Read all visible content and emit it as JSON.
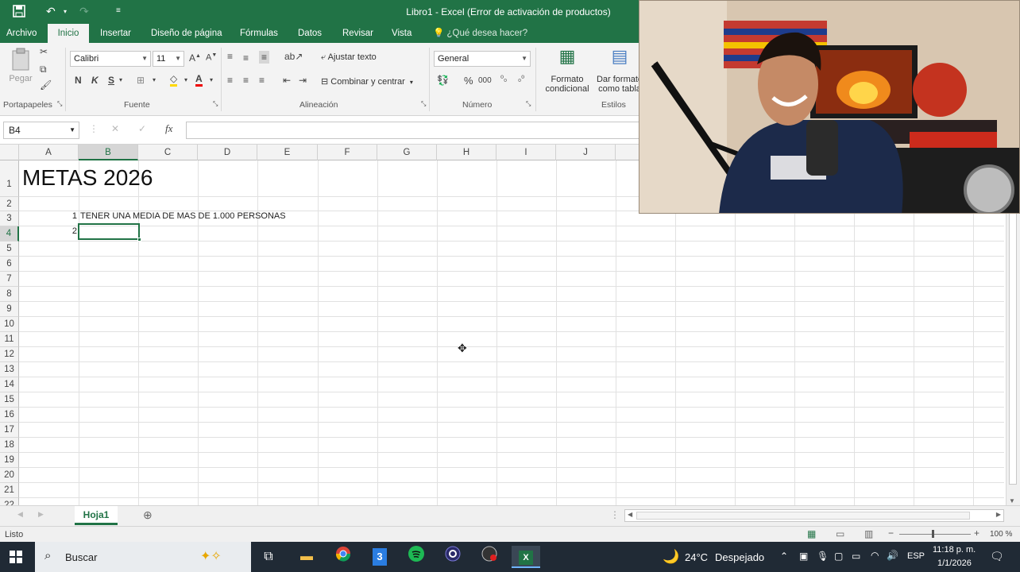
{
  "app": {
    "title": "Libro1 - Excel (Error de activación de productos)",
    "tabs": [
      "Archivo",
      "Inicio",
      "Insertar",
      "Diseño de página",
      "Fórmulas",
      "Datos",
      "Revisar",
      "Vista"
    ],
    "tell_me": "¿Qué desea hacer?"
  },
  "ribbon": {
    "paste_label": "Pegar",
    "font_name": "Calibri",
    "font_size": "11",
    "bold": "N",
    "italic": "K",
    "underline": "S",
    "wrap_text": "Ajustar texto",
    "merge_center": "Combinar y centrar",
    "number_format": "General",
    "percent": "%",
    "thousands": "000",
    "cond_format_1": "Formato",
    "cond_format_2": "condicional",
    "table_format_1": "Dar formato",
    "table_format_2": "como tabla",
    "groups": {
      "clipboard": "Portapapeles",
      "font": "Fuente",
      "alignment": "Alineación",
      "number": "Número",
      "styles": "Estilos"
    }
  },
  "formula_bar": {
    "name_box": "B4",
    "fx": "fx",
    "formula": ""
  },
  "grid": {
    "columns": [
      "A",
      "B",
      "C",
      "D",
      "E",
      "F",
      "G",
      "H",
      "I",
      "J"
    ],
    "rows": [
      "1",
      "2",
      "3",
      "4",
      "5",
      "6",
      "7",
      "8",
      "9",
      "10",
      "11",
      "12",
      "13",
      "14",
      "15",
      "16",
      "17",
      "18",
      "19",
      "20",
      "21",
      "22"
    ],
    "cells": {
      "A1": "METAS 2026",
      "A3": "1",
      "B3": "TENER UNA MEDIA DE MAS DE 1.000 PERSONAS",
      "A4": "2"
    },
    "selected_cell": "B4"
  },
  "sheets": {
    "tabs": [
      "Hoja1"
    ],
    "active": "Hoja1"
  },
  "status": {
    "ready": "Listo",
    "zoom": "100 %"
  },
  "taskbar": {
    "search": "Buscar",
    "weather_temp": "24°C",
    "weather_desc": "Despejado",
    "lang": "ESP",
    "time": "11:18 p. m.",
    "date": "1/1/2026"
  },
  "colors": {
    "excel_green": "#217346",
    "taskbar": "#202a35"
  }
}
